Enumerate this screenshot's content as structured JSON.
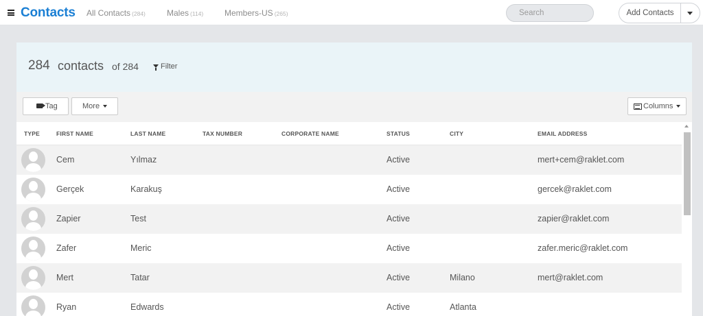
{
  "app": {
    "title": "Contacts"
  },
  "nav": {
    "tabs": [
      {
        "label": "All Contacts",
        "count": "(284)"
      },
      {
        "label": "Males",
        "count": "(114)"
      },
      {
        "label": "Members-US",
        "count": "(265)"
      }
    ]
  },
  "search": {
    "placeholder": "Search"
  },
  "add_contacts": {
    "label": "Add Contacts"
  },
  "summary": {
    "count": "284",
    "word": "contacts",
    "of_total": "of 284",
    "filter_label": "Filter"
  },
  "toolbar": {
    "tag_label": "Tag",
    "more_label": "More",
    "columns_label": "Columns"
  },
  "table": {
    "columns": [
      "TYPE",
      "FIRST NAME",
      "LAST NAME",
      "TAX NUMBER",
      "CORPORATE NAME",
      "STATUS",
      "CITY",
      "EMAIL ADDRESS"
    ],
    "rows": [
      {
        "first_name": "Cem",
        "last_name": "Yılmaz",
        "tax_number": "",
        "corporate_name": "",
        "status": "Active",
        "city": "",
        "email": "mert+cem@raklet.com"
      },
      {
        "first_name": "Gerçek",
        "last_name": "Karakuş",
        "tax_number": "",
        "corporate_name": "",
        "status": "Active",
        "city": "",
        "email": "gercek@raklet.com"
      },
      {
        "first_name": "Zapier",
        "last_name": "Test",
        "tax_number": "",
        "corporate_name": "",
        "status": "Active",
        "city": "",
        "email": "zapier@raklet.com"
      },
      {
        "first_name": "Zafer",
        "last_name": "Meric",
        "tax_number": "",
        "corporate_name": "",
        "status": "Active",
        "city": "",
        "email": "zafer.meric@raklet.com"
      },
      {
        "first_name": "Mert",
        "last_name": "Tatar",
        "tax_number": "",
        "corporate_name": "",
        "status": "Active",
        "city": "Milano",
        "email": "mert@raklet.com"
      },
      {
        "first_name": "Ryan",
        "last_name": "Edwards",
        "tax_number": "",
        "corporate_name": "",
        "status": "Active",
        "city": "Atlanta",
        "email": ""
      }
    ]
  }
}
